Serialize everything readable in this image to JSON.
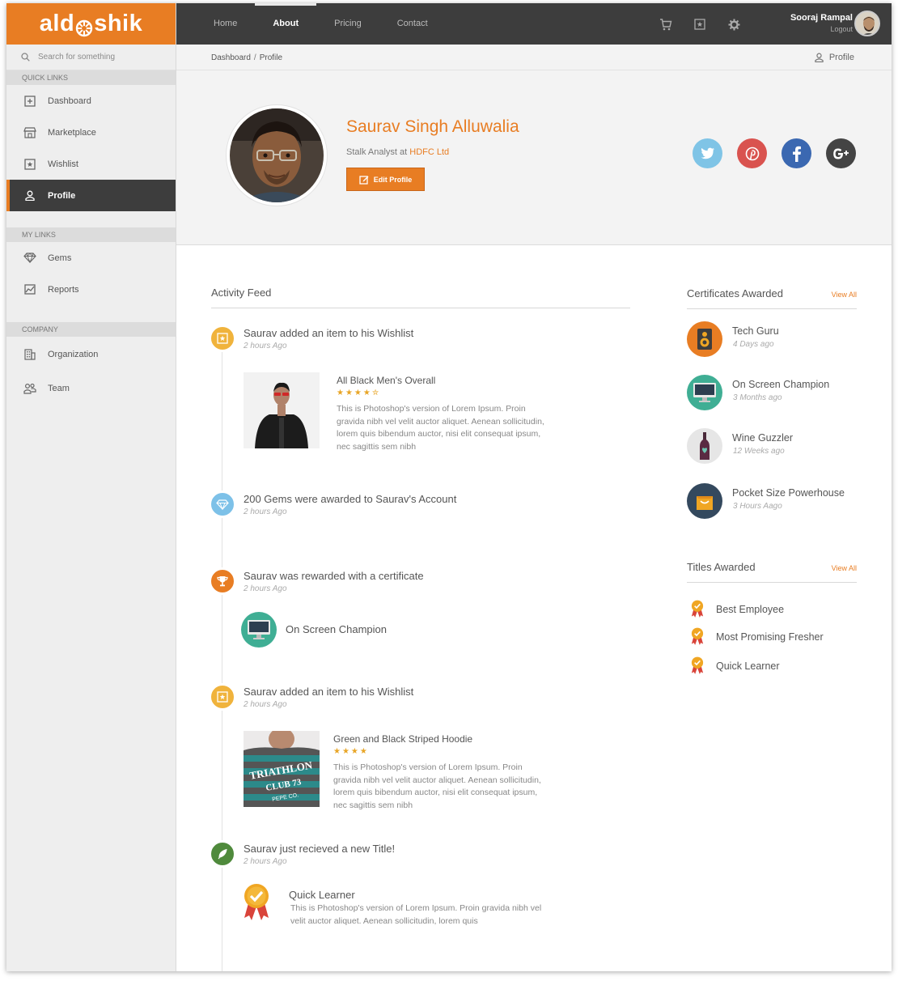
{
  "app": {
    "logo_text_1": "ald",
    "logo_text_2": "shik"
  },
  "colors": {
    "accent": "#e87d23",
    "dark": "#3d3d3d"
  },
  "search": {
    "placeholder": "Search for something"
  },
  "sidebar": {
    "quick_links_title": "QUICK LINKS",
    "quick_links": [
      {
        "label": "Dashboard",
        "icon": "dashboard-icon"
      },
      {
        "label": "Marketplace",
        "icon": "store-icon"
      },
      {
        "label": "Wishlist",
        "icon": "wishlist-star-icon"
      },
      {
        "label": "Profile",
        "icon": "user-icon",
        "active": true
      }
    ],
    "my_links_title": "MY LINKS",
    "my_links": [
      {
        "label": "Gems",
        "icon": "diamond-icon"
      },
      {
        "label": "Reports",
        "icon": "chart-icon"
      }
    ],
    "company_title": "COMPANY",
    "company": [
      {
        "label": "Organization",
        "icon": "building-icon"
      },
      {
        "label": "Team",
        "icon": "team-icon"
      }
    ]
  },
  "topnav": {
    "items": [
      "Home",
      "About",
      "Pricing",
      "Contact"
    ],
    "active": "About"
  },
  "user": {
    "name": "Sooraj Rampal",
    "logout": "Logout"
  },
  "breadcrumb": {
    "items": [
      "Dashboard",
      "Profile"
    ],
    "right_label": "Profile"
  },
  "profile": {
    "name": "Saurav Singh Alluwalia",
    "role": "Stalk Analyst at",
    "company": "HDFC Ltd",
    "edit_label": "Edit Profile",
    "socials": [
      "twitter",
      "pinterest",
      "facebook",
      "google-plus"
    ]
  },
  "feed": {
    "title": "Activity Feed",
    "events": [
      {
        "title": "Saurav added an item to his Wishlist",
        "time": "2 hours Ago",
        "icon": "wishlist-star-icon"
      },
      {
        "title": "200 Gems were awarded to Saurav's Account",
        "time": "2 hours Ago",
        "icon": "diamond-icon"
      },
      {
        "title": "Saurav was rewarded with a certificate",
        "time": "2 hours Ago",
        "icon": "trophy-icon"
      },
      {
        "title": "Saurav added an item to his Wishlist",
        "time": "2 hours Ago",
        "icon": "wishlist-star-icon"
      },
      {
        "title": "Saurav just recieved a new Title!",
        "time": "2 hours Ago",
        "icon": "feather-icon"
      }
    ],
    "product_1": {
      "name": "All Black Men's Overall",
      "stars": "★★★★✮",
      "desc": "This is Photoshop's version  of Lorem Ipsum. Proin gravida nibh vel velit auctor aliquet. Aenean sollicitudin, lorem quis bibendum auctor, nisi elit consequat ipsum, nec sagittis sem nibh"
    },
    "certificate": {
      "name": "On Screen Champion"
    },
    "product_2": {
      "name": "Green and Black Striped Hoodie",
      "stars": "★★★★",
      "desc": "This is Photoshop's version  of Lorem Ipsum. Proin gravida nibh vel velit auctor aliquet. Aenean sollicitudin, lorem quis bibendum auctor, nisi elit consequat ipsum, nec sagittis sem nibh",
      "shirt_text_1": "TRIATHLON",
      "shirt_text_2": "CLUB 73",
      "shirt_text_3": "PEPE CO."
    },
    "title_award": {
      "name": "Quick Learner",
      "desc": "This is Photoshop's version  of Lorem Ipsum. Proin gravida nibh vel velit auctor aliquet. Aenean sollicitudin, lorem quis"
    }
  },
  "certificates": {
    "title": "Certificates Awarded",
    "view_all": "View All",
    "items": [
      {
        "name": "Tech Guru",
        "time": "4 Days ago",
        "icon": "speaker-icon"
      },
      {
        "name": "On Screen Champion",
        "time": "3 Months ago",
        "icon": "monitor-icon"
      },
      {
        "name": "Wine Guzzler",
        "time": "12 Weeks ago",
        "icon": "wine-bottle-icon"
      },
      {
        "name": "Pocket Size Powerhouse",
        "time": "3 Hours Aago",
        "icon": "bag-icon"
      }
    ]
  },
  "titles": {
    "title": "Titles Awarded",
    "view_all": "View All",
    "items": [
      "Best Employee",
      "Most Promising Fresher",
      "Quick Learner"
    ]
  }
}
